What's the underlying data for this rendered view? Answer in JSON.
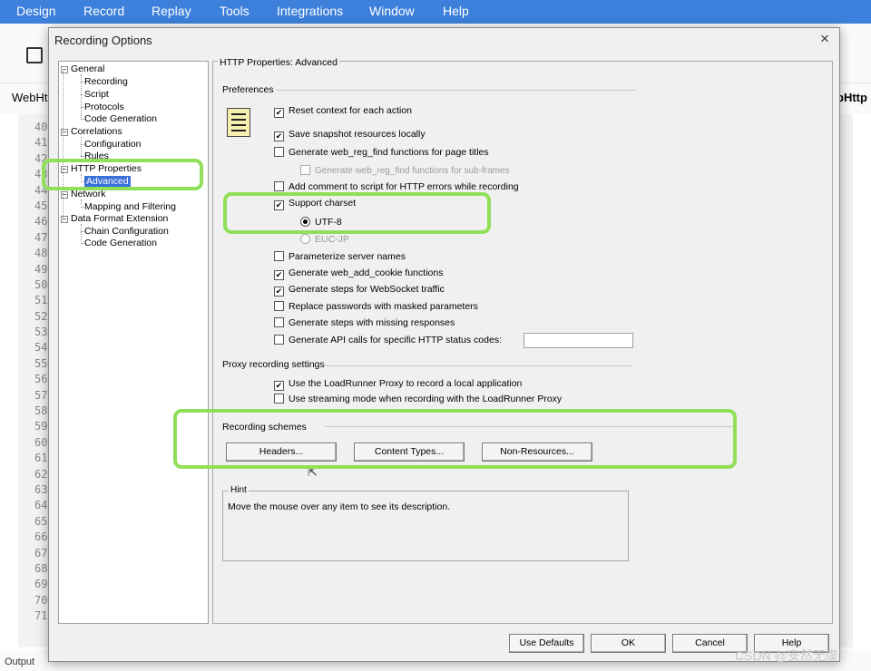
{
  "menu": [
    "Design",
    "Record",
    "Replay",
    "Tools",
    "Integrations",
    "Window",
    "Help"
  ],
  "background": {
    "tab_left": "WebHt",
    "tab_right": "bHttp",
    "line_numbers": [
      "40",
      "41",
      "42",
      "43",
      "44",
      "45",
      "46",
      "47",
      "48",
      "49",
      "50",
      "51",
      "52",
      "53",
      "54",
      "55",
      "56",
      "57",
      "58",
      "59",
      "60",
      "61",
      "62",
      "63",
      "64",
      "65",
      "66",
      "67",
      "68",
      "69",
      "70",
      "71"
    ],
    "output_label": "Output",
    "watermark": "CSDN @安然无虞"
  },
  "dialog": {
    "title": "Recording Options",
    "close": "×"
  },
  "tree": {
    "general": "General",
    "recording": "Recording",
    "script": "Script",
    "protocols": "Protocols",
    "code_generation": "Code Generation",
    "correlations": "Correlations",
    "configuration": "Configuration",
    "rules": "Rules",
    "http_properties": "HTTP Properties",
    "advanced": "Advanced",
    "network": "Network",
    "mapping_filtering": "Mapping and Filtering",
    "data_format_extension": "Data Format Extension",
    "chain_configuration": "Chain Configuration",
    "code_generation_2": "Code Generation"
  },
  "panel": {
    "title": "HTTP Properties: Advanced",
    "preferences": "Preferences",
    "options": [
      {
        "label": "Reset context for each action",
        "checked": true
      },
      {
        "label": "Save snapshot resources locally",
        "checked": true
      },
      {
        "label": "Generate web_reg_find functions for page titles",
        "checked": false
      },
      {
        "label": "Generate web_reg_find functions for sub-frames",
        "checked": false,
        "disabled": true
      },
      {
        "label": "Add comment to script for HTTP errors while recording",
        "checked": false
      },
      {
        "label": "Support charset",
        "checked": true
      },
      {
        "label": "UTF-8",
        "selected": true
      },
      {
        "label": "EUC-JP",
        "selected": false,
        "disabled": true
      },
      {
        "label": "Parameterize server names",
        "checked": false
      },
      {
        "label": "Generate web_add_cookie functions",
        "checked": true
      },
      {
        "label": "Generate steps for WebSocket traffic",
        "checked": true
      },
      {
        "label": "Replace passwords with masked parameters",
        "checked": false
      },
      {
        "label": "Generate steps with missing responses",
        "checked": false
      },
      {
        "label": "Generate API calls for specific HTTP status codes:",
        "checked": false
      }
    ],
    "status_codes_value": "",
    "proxy_section": "Proxy recording settings",
    "proxy_options": [
      {
        "label": "Use the LoadRunner Proxy to record a local application",
        "checked": true
      },
      {
        "label": "Use streaming mode when recording with the LoadRunner Proxy",
        "checked": false
      }
    ],
    "schemes_section": "Recording schemes",
    "headers_btn": "Headers...",
    "content_types_btn": "Content Types...",
    "non_resources_btn": "Non-Resources...",
    "hint_label": "Hint",
    "hint_text": "Move the mouse over any item to see its description."
  },
  "footer": {
    "use_defaults": "Use Defaults",
    "ok": "OK",
    "cancel": "Cancel",
    "help": "Help"
  },
  "colors": {
    "menubar": "#3c80db",
    "highlight": "#8fe058",
    "selection": "#3a6fd8"
  }
}
